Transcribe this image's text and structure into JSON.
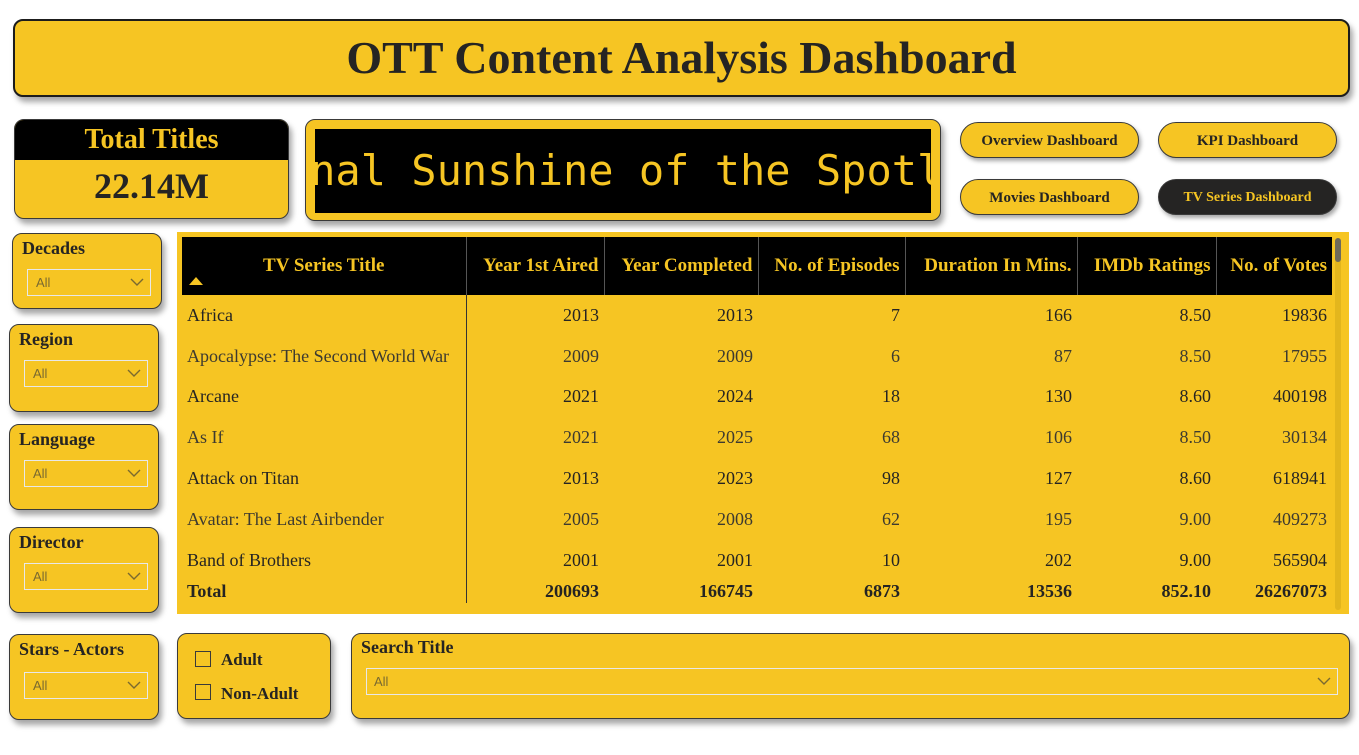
{
  "title": "OTT Content Analysis Dashboard",
  "kpi": {
    "label": "Total Titles",
    "value": "22.14M"
  },
  "ticker": {
    "text": "Eternal Sunshine of the Spotless Mind"
  },
  "nav": {
    "overview": "Overview Dashboard",
    "kpi": "KPI Dashboard",
    "movies": "Movies Dashboard",
    "tv": "TV Series Dashboard"
  },
  "slicers": {
    "decades": {
      "label": "Decades",
      "value": "All"
    },
    "region": {
      "label": "Region",
      "value": "All"
    },
    "language": {
      "label": "Language",
      "value": "All"
    },
    "director": {
      "label": "Director",
      "value": "All"
    },
    "stars": {
      "label": "Stars - Actors",
      "value": "All"
    }
  },
  "filters": {
    "adult": "Adult",
    "non_adult": "Non-Adult"
  },
  "search": {
    "label": "Search Title",
    "value": "All"
  },
  "table": {
    "columns": [
      "TV Series Title",
      "Year 1st Aired",
      "Year Completed",
      "No. of Episodes",
      "Duration In Mins.",
      "IMDb Ratings",
      "No. of Votes"
    ],
    "rows": [
      [
        "Africa",
        "2013",
        "2013",
        "7",
        "166",
        "8.50",
        "19836"
      ],
      [
        "Apocalypse: The Second World War",
        "2009",
        "2009",
        "6",
        "87",
        "8.50",
        "17955"
      ],
      [
        "Arcane",
        "2021",
        "2024",
        "18",
        "130",
        "8.60",
        "400198"
      ],
      [
        "As If",
        "2021",
        "2025",
        "68",
        "106",
        "8.50",
        "30134"
      ],
      [
        "Attack on Titan",
        "2013",
        "2023",
        "98",
        "127",
        "8.60",
        "618941"
      ],
      [
        "Avatar: The Last Airbender",
        "2005",
        "2008",
        "62",
        "195",
        "9.00",
        "409273"
      ],
      [
        "Band of Brothers",
        "2001",
        "2001",
        "10",
        "202",
        "9.00",
        "565904"
      ]
    ],
    "total": [
      "Total",
      "200693",
      "166745",
      "6873",
      "13536",
      "852.10",
      "26267073"
    ]
  },
  "colors": {
    "accent": "#f6c523",
    "dark": "#000000",
    "text": "#252423"
  }
}
